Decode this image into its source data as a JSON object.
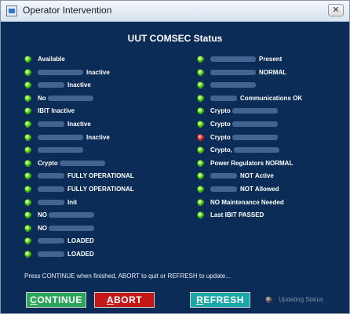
{
  "window": {
    "title": "Operator Intervention",
    "close_glyph": "✕",
    "icon": "app-window-icon"
  },
  "panel": {
    "heading": "UUT COMSEC Status"
  },
  "status": {
    "left": [
      {
        "pre": "",
        "text": "Available",
        "blur": "",
        "after": "",
        "color": "green"
      },
      {
        "pre": "",
        "text": "",
        "blur": "long",
        "after": "Inactive",
        "color": "green"
      },
      {
        "pre": "",
        "text": "",
        "blur": "short",
        "after": "Inactive",
        "color": "green"
      },
      {
        "pre": "No",
        "text": "",
        "blur": "long",
        "after": "",
        "color": "green"
      },
      {
        "pre": "",
        "text": "IBIT Inactive",
        "blur": "",
        "after": "",
        "color": "green"
      },
      {
        "pre": "",
        "text": "",
        "blur": "short",
        "after": "Inactive",
        "color": "green"
      },
      {
        "pre": "",
        "text": "",
        "blur": "long",
        "after": "Inactive",
        "color": "green"
      },
      {
        "pre": "",
        "text": "",
        "blur": "long",
        "after": "",
        "color": "green"
      },
      {
        "pre": "Crypto",
        "text": "",
        "blur": "long",
        "after": "",
        "color": "green"
      },
      {
        "pre": "",
        "text": "",
        "blur": "short",
        "after": "FULLY OPERATIONAL",
        "color": "green"
      },
      {
        "pre": "",
        "text": "",
        "blur": "short",
        "after": "FULLY OPERATIONAL",
        "color": "green"
      },
      {
        "pre": "",
        "text": "",
        "blur": "short",
        "after": "Init",
        "color": "green"
      },
      {
        "pre": "NO",
        "text": "",
        "blur": "long",
        "after": "",
        "color": "green"
      },
      {
        "pre": "NO",
        "text": "",
        "blur": "long",
        "after": "",
        "color": "green"
      },
      {
        "pre": "",
        "text": "",
        "blur": "short",
        "after": "LOADED",
        "color": "green"
      },
      {
        "pre": "",
        "text": "",
        "blur": "short",
        "after": "LOADED",
        "color": "green"
      }
    ],
    "right": [
      {
        "pre": "",
        "text": "",
        "blur": "long",
        "after": "Present",
        "color": "green"
      },
      {
        "pre": "",
        "text": "",
        "blur": "long",
        "after": "NORMAL",
        "color": "green"
      },
      {
        "pre": "",
        "text": "",
        "blur": "long",
        "after": "",
        "color": "green"
      },
      {
        "pre": "",
        "text": "",
        "blur": "short",
        "after": "Communications OK",
        "color": "green"
      },
      {
        "pre": "Crypto",
        "text": "",
        "blur": "long",
        "after": "",
        "color": "green"
      },
      {
        "pre": "Crypto",
        "text": "",
        "blur": "long",
        "after": "",
        "color": "green"
      },
      {
        "pre": "Crypto",
        "text": "",
        "blur": "long",
        "after": "",
        "color": "red"
      },
      {
        "pre": "Crypto,",
        "text": "",
        "blur": "long",
        "after": "",
        "color": "green"
      },
      {
        "pre": "",
        "text": "Power Regulators NORMAL",
        "blur": "",
        "after": "",
        "color": "green"
      },
      {
        "pre": "",
        "text": "",
        "blur": "short",
        "after": "NOT Active",
        "color": "green"
      },
      {
        "pre": "",
        "text": "",
        "blur": "short",
        "after": "NOT Allowed",
        "color": "green"
      },
      {
        "pre": "",
        "text": "NO Maintenance Needed",
        "blur": "",
        "after": "",
        "color": "green"
      },
      {
        "pre": "",
        "text": "Last IBIT PASSED",
        "blur": "",
        "after": "",
        "color": "green"
      }
    ]
  },
  "footer": {
    "message": "Press CONTINUE when finished, ABORT to quit or REFRESH to update...",
    "buttons": {
      "continue": {
        "first": "C",
        "rest": "ONTINUE"
      },
      "abort": {
        "first": "A",
        "rest": "BORT"
      },
      "refresh": {
        "first": "R",
        "rest": "EFRESH"
      }
    },
    "updating_label": "Updating Status"
  },
  "colors": {
    "panel_bg": "#0b2c57",
    "continue": "#2aa55a",
    "abort": "#c41818",
    "refresh": "#1aa7a7",
    "led_green": "#4fd115",
    "led_red": "#ef2a2a"
  }
}
